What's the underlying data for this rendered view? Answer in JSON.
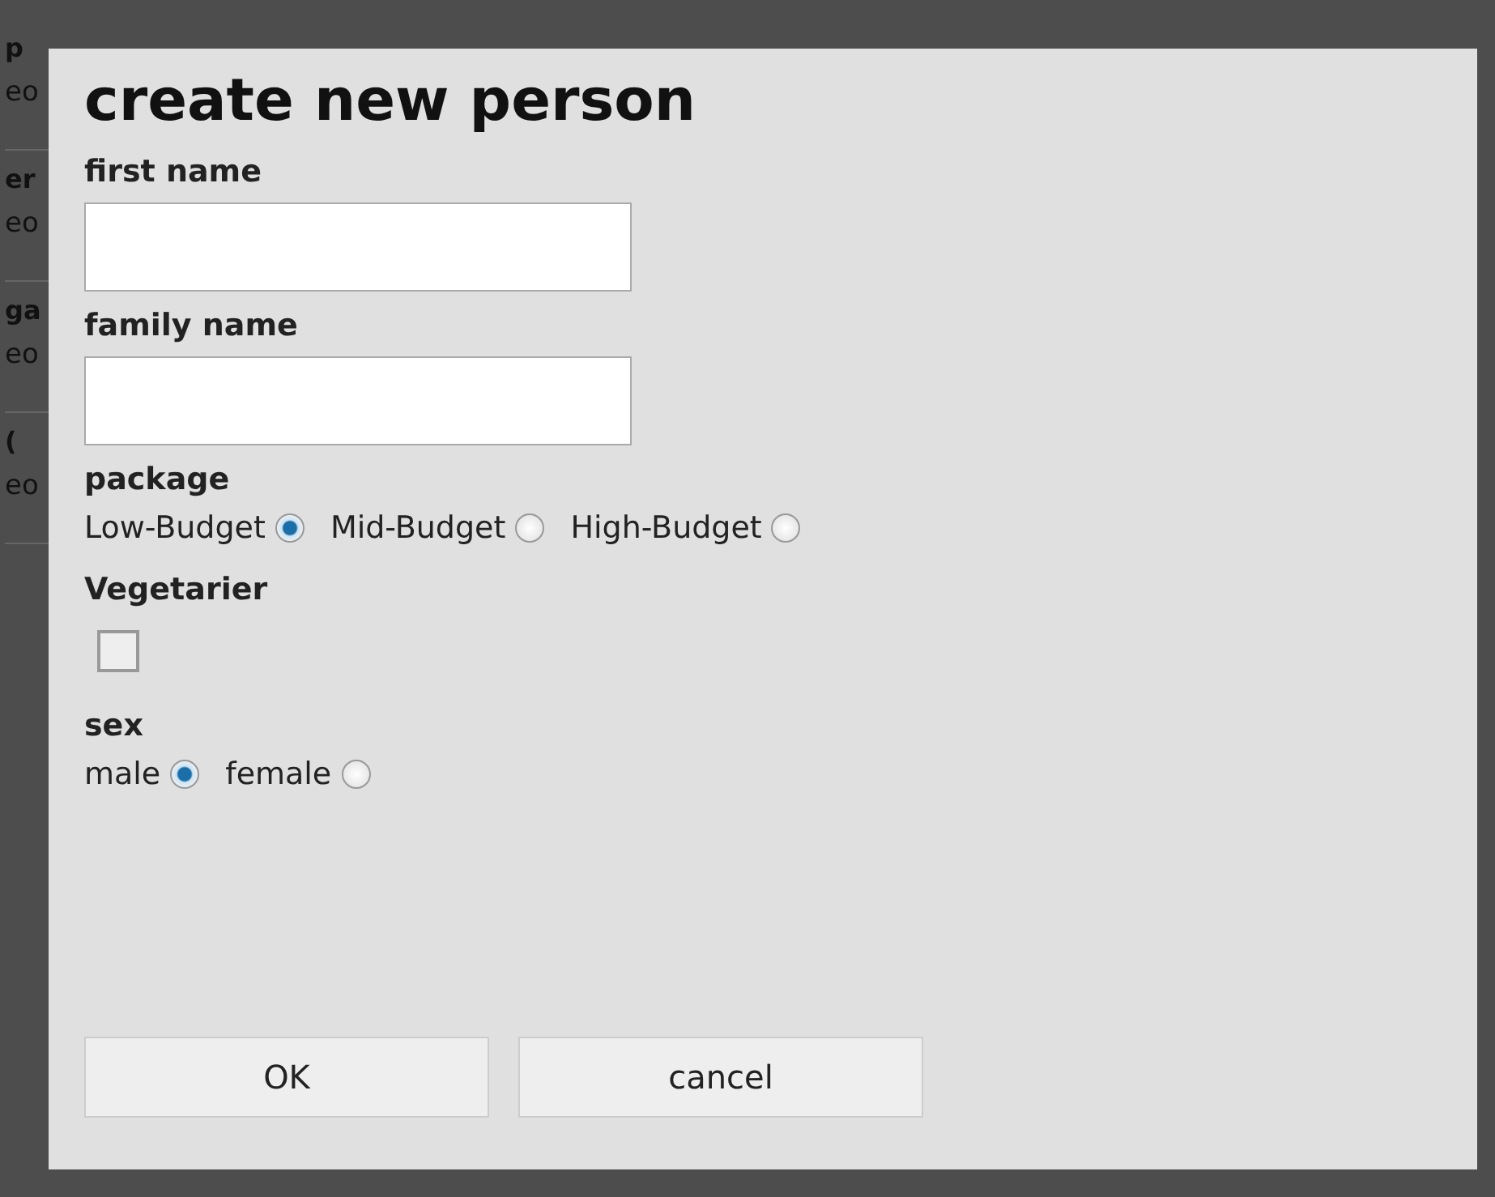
{
  "background_list": [
    {
      "title": "p",
      "subtitle": "eo"
    },
    {
      "title": "er",
      "subtitle": "eo"
    },
    {
      "title": "ga",
      "subtitle": "eo"
    },
    {
      "title": "(",
      "subtitle": "eo"
    }
  ],
  "dialog": {
    "title": "create new person",
    "fields": [
      {
        "label": "first name"
      },
      {
        "label": "family name"
      }
    ],
    "package": {
      "label": "package",
      "options": [
        {
          "label": "Low-Budget",
          "selected": true
        },
        {
          "label": "Mid-Budget",
          "selected": false
        },
        {
          "label": "High-Budget",
          "selected": false
        }
      ]
    },
    "vegetarian": {
      "label": "Vegetarier",
      "checked": false
    },
    "sex": {
      "label": "sex",
      "options": [
        {
          "label": "male",
          "selected": true
        },
        {
          "label": "female",
          "selected": false
        }
      ]
    },
    "buttons": [
      "OK",
      "cancel"
    ]
  }
}
